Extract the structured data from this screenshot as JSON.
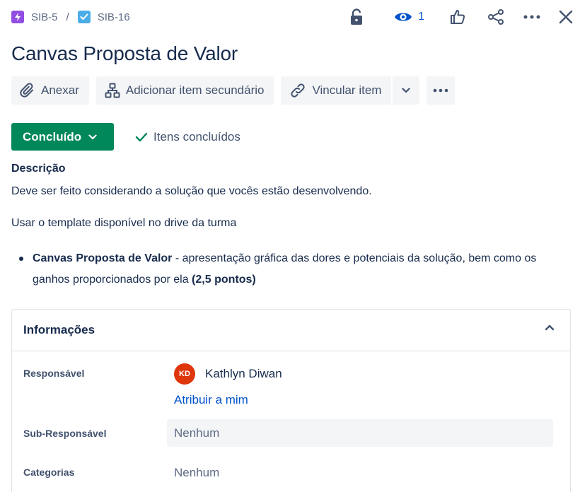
{
  "breadcrumb": {
    "parent_key": "SIB-5",
    "separator": "/",
    "current_key": "SIB-16"
  },
  "header": {
    "watch_count": "1",
    "icons": [
      "lock-open-icon",
      "eye-icon",
      "thumbs-up-icon",
      "share-icon",
      "more-icon",
      "close-icon"
    ]
  },
  "issue": {
    "title": "Canvas Proposta de Valor"
  },
  "toolbar": {
    "attach_label": "Anexar",
    "add_child_label": "Adicionar item secundário",
    "link_label": "Vincular item"
  },
  "status": {
    "label": "Concluído",
    "done_items_label": "Itens concluídos",
    "color": "#00875a"
  },
  "description": {
    "heading": "Descrição",
    "paragraph1": "Deve ser feito considerando a solução que vocês estão desenvolvendo.",
    "paragraph2": "Usar o template disponível no drive da turma",
    "bullet_bold": "Canvas Proposta de Valor",
    "bullet_text": " - apresentação gráfica das dores e potenciais da solução, bem como os ganhos proporcionados por ela ",
    "bullet_points": "(2,5 pontos)"
  },
  "info_panel": {
    "heading": "Informações",
    "fields": {
      "assignee_label": "Responsável",
      "assignee_initials": "KD",
      "assignee_name": "Kathlyn Diwan",
      "assign_to_me": "Atribuir a mim",
      "sub_assignee_label": "Sub-Responsável",
      "sub_assignee_value": "Nenhum",
      "categories_label": "Categorias",
      "categories_value": "Nenhum"
    }
  },
  "colors": {
    "link": "#0052cc",
    "avatar": "#de350b",
    "epic": "#904ee2",
    "task": "#4bade8"
  }
}
